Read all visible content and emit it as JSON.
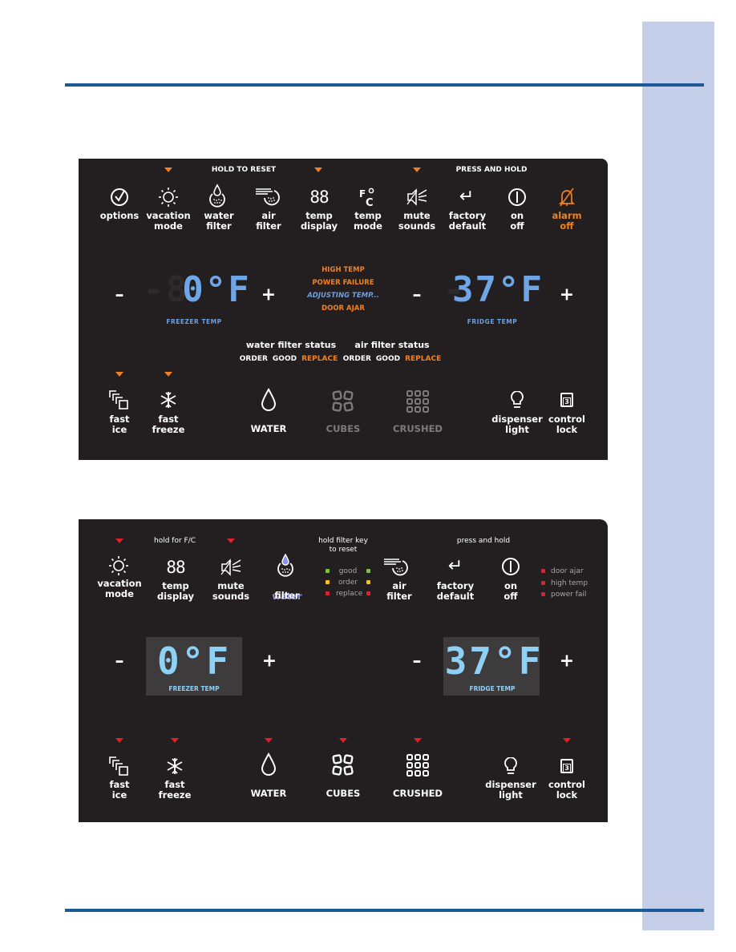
{
  "page": {
    "colors": {
      "rule": "#1b5a96",
      "side_tab": "#c5cee8",
      "panel_bg": "#231f20",
      "orange_accent": "#f08020",
      "red_accent": "#e0202a",
      "display_blue_1": "#6fa6e8",
      "display_blue_2": "#8fd0f6",
      "led_green": "#7dc242",
      "led_yellow": "#f7c21b",
      "led_red": "#e0202a"
    }
  },
  "panel1": {
    "headers": {
      "hold_to_reset": "HOLD TO RESET",
      "press_and_hold": "PRESS AND HOLD"
    },
    "top_buttons": [
      {
        "id": "options",
        "label": "options",
        "icon": "check-circle-icon"
      },
      {
        "id": "vacation-mode",
        "label": "vacation\nmode",
        "icon": "sun-icon"
      },
      {
        "id": "water-filter",
        "label": "water\nfilter",
        "icon": "water-filter-icon"
      },
      {
        "id": "air-filter",
        "label": "air\nfilter",
        "icon": "air-filter-icon"
      },
      {
        "id": "temp-display",
        "label": "temp\ndisplay",
        "icon": "88-digits-icon",
        "glyph": "88"
      },
      {
        "id": "temp-mode",
        "label": "temp\nmode",
        "icon": "fahrenheit-celsius-icon"
      },
      {
        "id": "mute-sounds",
        "label": "mute\nsounds",
        "icon": "speaker-mute-icon"
      },
      {
        "id": "factory-default",
        "label": "factory\ndefault",
        "icon": "return-arrow-icon",
        "glyph": "↵"
      },
      {
        "id": "on-off",
        "label": "on\noff",
        "icon": "power-icon"
      },
      {
        "id": "alarm-off",
        "label": "alarm\noff",
        "icon": "bell-off-icon",
        "highlight": true
      }
    ],
    "freezer": {
      "minus": "–",
      "plus": "+",
      "ghost_digits": "-8",
      "value": "0°F",
      "caption": "FREEZER TEMP"
    },
    "fridge": {
      "minus": "–",
      "plus": "+",
      "ghost_digits": "-",
      "value": "37°F",
      "caption": "FRIDGE TEMP"
    },
    "status_messages": [
      "HIGH TEMP",
      "POWER FAILURE",
      "ADJUSTING TEMP...",
      "DOOR AJAR"
    ],
    "water_filter_status": {
      "title": "water filter status",
      "order": "ORDER",
      "good": "GOOD",
      "replace": "REPLACE"
    },
    "air_filter_status": {
      "title": "air filter status",
      "order": "ORDER",
      "good": "GOOD",
      "replace": "REPLACE"
    },
    "bottom_buttons": [
      {
        "id": "fast-ice",
        "label": "fast\nice"
      },
      {
        "id": "fast-freeze",
        "label": "fast\nfreeze"
      },
      {
        "id": "water",
        "label": "WATER"
      },
      {
        "id": "cubes",
        "label": "CUBES",
        "dimmed": true
      },
      {
        "id": "crushed",
        "label": "CRUSHED",
        "dimmed": true
      },
      {
        "id": "dispenser-light",
        "label": "dispenser\nlight"
      },
      {
        "id": "control-lock",
        "label": "control\nlock",
        "glyph": "3"
      }
    ]
  },
  "panel2": {
    "headers": {
      "hold_for_fc": "hold for F/C",
      "hold_filter_key": "hold filter key\nto reset",
      "press_and_hold": "press and hold"
    },
    "top_buttons": [
      {
        "id": "vacation-mode",
        "label": "vacation\nmode"
      },
      {
        "id": "temp-display",
        "label": "temp\ndisplay",
        "glyph": "88"
      },
      {
        "id": "mute-sounds",
        "label": "mute\nsounds"
      },
      {
        "id": "water-filter",
        "label": "water\nfilter",
        "highlight": true
      },
      {
        "id": "air-filter",
        "label": "air\nfilter"
      },
      {
        "id": "factory-default",
        "label": "factory\ndefault",
        "glyph": "↵"
      },
      {
        "id": "on-off",
        "label": "on\noff"
      }
    ],
    "filter_leds": [
      "good",
      "order",
      "replace"
    ],
    "alert_leds": [
      "door ajar",
      "high temp",
      "power fail"
    ],
    "freezer": {
      "minus": "–",
      "plus": "+",
      "value": "0°F",
      "caption": "FREEZER TEMP"
    },
    "fridge": {
      "minus": "–",
      "plus": "+",
      "value": "37°F",
      "caption": "FRIDGE TEMP"
    },
    "bottom_buttons": [
      {
        "id": "fast-ice",
        "label": "fast\nice"
      },
      {
        "id": "fast-freeze",
        "label": "fast\nfreeze"
      },
      {
        "id": "water",
        "label": "WATER"
      },
      {
        "id": "cubes",
        "label": "CUBES"
      },
      {
        "id": "crushed",
        "label": "CRUSHED"
      },
      {
        "id": "dispenser-light",
        "label": "dispenser\nlight"
      },
      {
        "id": "control-lock",
        "label": "control\nlock",
        "glyph": "3"
      }
    ]
  }
}
